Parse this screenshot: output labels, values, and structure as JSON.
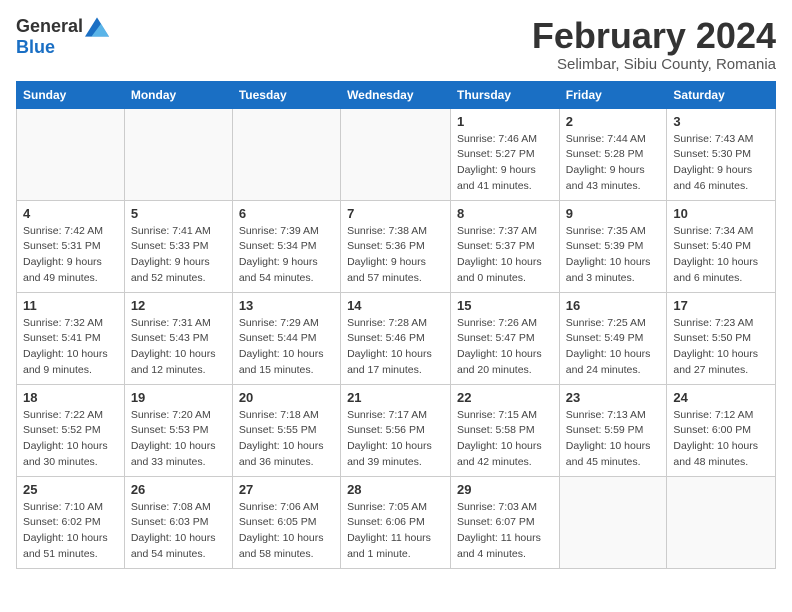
{
  "logo": {
    "general": "General",
    "blue": "Blue"
  },
  "title": "February 2024",
  "location": "Selimbar, Sibiu County, Romania",
  "days_of_week": [
    "Sunday",
    "Monday",
    "Tuesday",
    "Wednesday",
    "Thursday",
    "Friday",
    "Saturday"
  ],
  "weeks": [
    [
      {
        "day": "",
        "info": ""
      },
      {
        "day": "",
        "info": ""
      },
      {
        "day": "",
        "info": ""
      },
      {
        "day": "",
        "info": ""
      },
      {
        "day": "1",
        "info": "Sunrise: 7:46 AM\nSunset: 5:27 PM\nDaylight: 9 hours\nand 41 minutes."
      },
      {
        "day": "2",
        "info": "Sunrise: 7:44 AM\nSunset: 5:28 PM\nDaylight: 9 hours\nand 43 minutes."
      },
      {
        "day": "3",
        "info": "Sunrise: 7:43 AM\nSunset: 5:30 PM\nDaylight: 9 hours\nand 46 minutes."
      }
    ],
    [
      {
        "day": "4",
        "info": "Sunrise: 7:42 AM\nSunset: 5:31 PM\nDaylight: 9 hours\nand 49 minutes."
      },
      {
        "day": "5",
        "info": "Sunrise: 7:41 AM\nSunset: 5:33 PM\nDaylight: 9 hours\nand 52 minutes."
      },
      {
        "day": "6",
        "info": "Sunrise: 7:39 AM\nSunset: 5:34 PM\nDaylight: 9 hours\nand 54 minutes."
      },
      {
        "day": "7",
        "info": "Sunrise: 7:38 AM\nSunset: 5:36 PM\nDaylight: 9 hours\nand 57 minutes."
      },
      {
        "day": "8",
        "info": "Sunrise: 7:37 AM\nSunset: 5:37 PM\nDaylight: 10 hours\nand 0 minutes."
      },
      {
        "day": "9",
        "info": "Sunrise: 7:35 AM\nSunset: 5:39 PM\nDaylight: 10 hours\nand 3 minutes."
      },
      {
        "day": "10",
        "info": "Sunrise: 7:34 AM\nSunset: 5:40 PM\nDaylight: 10 hours\nand 6 minutes."
      }
    ],
    [
      {
        "day": "11",
        "info": "Sunrise: 7:32 AM\nSunset: 5:41 PM\nDaylight: 10 hours\nand 9 minutes."
      },
      {
        "day": "12",
        "info": "Sunrise: 7:31 AM\nSunset: 5:43 PM\nDaylight: 10 hours\nand 12 minutes."
      },
      {
        "day": "13",
        "info": "Sunrise: 7:29 AM\nSunset: 5:44 PM\nDaylight: 10 hours\nand 15 minutes."
      },
      {
        "day": "14",
        "info": "Sunrise: 7:28 AM\nSunset: 5:46 PM\nDaylight: 10 hours\nand 17 minutes."
      },
      {
        "day": "15",
        "info": "Sunrise: 7:26 AM\nSunset: 5:47 PM\nDaylight: 10 hours\nand 20 minutes."
      },
      {
        "day": "16",
        "info": "Sunrise: 7:25 AM\nSunset: 5:49 PM\nDaylight: 10 hours\nand 24 minutes."
      },
      {
        "day": "17",
        "info": "Sunrise: 7:23 AM\nSunset: 5:50 PM\nDaylight: 10 hours\nand 27 minutes."
      }
    ],
    [
      {
        "day": "18",
        "info": "Sunrise: 7:22 AM\nSunset: 5:52 PM\nDaylight: 10 hours\nand 30 minutes."
      },
      {
        "day": "19",
        "info": "Sunrise: 7:20 AM\nSunset: 5:53 PM\nDaylight: 10 hours\nand 33 minutes."
      },
      {
        "day": "20",
        "info": "Sunrise: 7:18 AM\nSunset: 5:55 PM\nDaylight: 10 hours\nand 36 minutes."
      },
      {
        "day": "21",
        "info": "Sunrise: 7:17 AM\nSunset: 5:56 PM\nDaylight: 10 hours\nand 39 minutes."
      },
      {
        "day": "22",
        "info": "Sunrise: 7:15 AM\nSunset: 5:58 PM\nDaylight: 10 hours\nand 42 minutes."
      },
      {
        "day": "23",
        "info": "Sunrise: 7:13 AM\nSunset: 5:59 PM\nDaylight: 10 hours\nand 45 minutes."
      },
      {
        "day": "24",
        "info": "Sunrise: 7:12 AM\nSunset: 6:00 PM\nDaylight: 10 hours\nand 48 minutes."
      }
    ],
    [
      {
        "day": "25",
        "info": "Sunrise: 7:10 AM\nSunset: 6:02 PM\nDaylight: 10 hours\nand 51 minutes."
      },
      {
        "day": "26",
        "info": "Sunrise: 7:08 AM\nSunset: 6:03 PM\nDaylight: 10 hours\nand 54 minutes."
      },
      {
        "day": "27",
        "info": "Sunrise: 7:06 AM\nSunset: 6:05 PM\nDaylight: 10 hours\nand 58 minutes."
      },
      {
        "day": "28",
        "info": "Sunrise: 7:05 AM\nSunset: 6:06 PM\nDaylight: 11 hours\nand 1 minute."
      },
      {
        "day": "29",
        "info": "Sunrise: 7:03 AM\nSunset: 6:07 PM\nDaylight: 11 hours\nand 4 minutes."
      },
      {
        "day": "",
        "info": ""
      },
      {
        "day": "",
        "info": ""
      }
    ]
  ]
}
